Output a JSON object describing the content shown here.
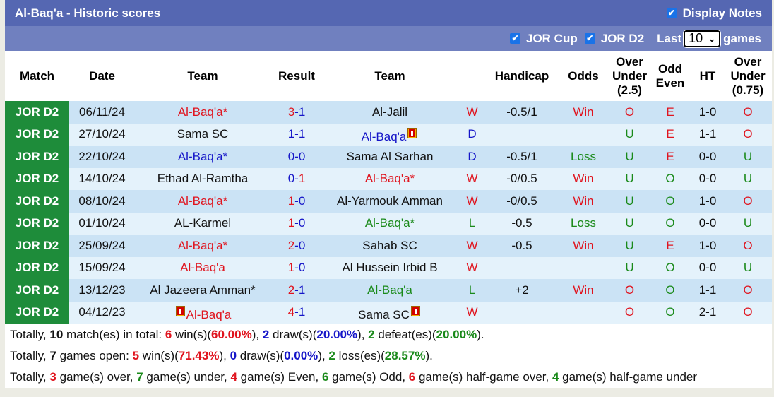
{
  "header": {
    "title": "Al-Baq'a - Historic scores",
    "display_notes_label": "Display Notes",
    "display_notes_checked": true
  },
  "filters": {
    "items": [
      {
        "label": "JOR Cup",
        "checked": true
      },
      {
        "label": "JOR D2",
        "checked": true
      }
    ],
    "last_label": "Last",
    "last_value": "10",
    "games_label": "games"
  },
  "columns": {
    "match": "Match",
    "date": "Date",
    "team1": "Team",
    "result": "Result",
    "team2": "Team",
    "handicap": "Handicap",
    "odds": "Odds",
    "ou_line1": "Over",
    "ou_line2": "Under",
    "ou_line3": "(2.5)",
    "oe_line1": "Odd",
    "oe_line2": "Even",
    "ht": "HT",
    "ou2_line1": "Over",
    "ou2_line2": "Under",
    "ou2_line3": "(0.75)"
  },
  "colors": {
    "title_bg": "#5567b2",
    "filter_bg": "#7080bf",
    "league_bg": "#1e8c3a",
    "row_odd": "#cbe3f5",
    "row_even": "#e4f2fb",
    "red": "#e0141e",
    "blue": "#1515c8",
    "green": "#1a8a1a"
  },
  "rows": [
    {
      "league": "JOR D2",
      "date": "06/11/24",
      "home": "Al-Baq'a*",
      "home_color": "red",
      "home_card_before": false,
      "home_card_after": false,
      "score_home": "3",
      "score_home_color": "red",
      "score_away": "1",
      "score_away_color": "blue",
      "away": "Al-Jalil",
      "away_color": "black",
      "away_card_before": false,
      "away_card_after": false,
      "wl": "W",
      "wl_color": "red",
      "handicap": "-0.5/1",
      "odds": "Win",
      "odds_color": "red",
      "ou": "O",
      "ou_color": "red",
      "oe": "E",
      "oe_color": "red",
      "ht": "1-0",
      "ou2": "O",
      "ou2_color": "red"
    },
    {
      "league": "JOR D2",
      "date": "27/10/24",
      "home": "Sama SC",
      "home_color": "black",
      "home_card_before": false,
      "home_card_after": false,
      "score_home": "1",
      "score_home_color": "blue",
      "score_away": "1",
      "score_away_color": "blue",
      "away": "Al-Baq'a",
      "away_color": "blue",
      "away_card_before": false,
      "away_card_after": true,
      "wl": "D",
      "wl_color": "blue",
      "handicap": "",
      "odds": "",
      "odds_color": "black",
      "ou": "U",
      "ou_color": "green",
      "oe": "E",
      "oe_color": "red",
      "ht": "1-1",
      "ou2": "O",
      "ou2_color": "red"
    },
    {
      "league": "JOR D2",
      "date": "22/10/24",
      "home": "Al-Baq'a*",
      "home_color": "blue",
      "home_card_before": false,
      "home_card_after": false,
      "score_home": "0",
      "score_home_color": "blue",
      "score_away": "0",
      "score_away_color": "blue",
      "away": "Sama Al Sarhan",
      "away_color": "black",
      "away_card_before": false,
      "away_card_after": false,
      "wl": "D",
      "wl_color": "blue",
      "handicap": "-0.5/1",
      "odds": "Loss",
      "odds_color": "green",
      "ou": "U",
      "ou_color": "green",
      "oe": "E",
      "oe_color": "red",
      "ht": "0-0",
      "ou2": "U",
      "ou2_color": "green"
    },
    {
      "league": "JOR D2",
      "date": "14/10/24",
      "home": "Ethad Al-Ramtha",
      "home_color": "black",
      "home_card_before": false,
      "home_card_after": false,
      "score_home": "0",
      "score_home_color": "blue",
      "score_away": "1",
      "score_away_color": "red",
      "away": "Al-Baq'a*",
      "away_color": "red",
      "away_card_before": false,
      "away_card_after": false,
      "wl": "W",
      "wl_color": "red",
      "handicap": "-0/0.5",
      "odds": "Win",
      "odds_color": "red",
      "ou": "U",
      "ou_color": "green",
      "oe": "O",
      "oe_color": "green",
      "ht": "0-0",
      "ou2": "U",
      "ou2_color": "green"
    },
    {
      "league": "JOR D2",
      "date": "08/10/24",
      "home": "Al-Baq'a*",
      "home_color": "red",
      "home_card_before": false,
      "home_card_after": false,
      "score_home": "1",
      "score_home_color": "red",
      "score_away": "0",
      "score_away_color": "blue",
      "away": "Al-Yarmouk Amman",
      "away_color": "black",
      "away_card_before": false,
      "away_card_after": false,
      "wl": "W",
      "wl_color": "red",
      "handicap": "-0/0.5",
      "odds": "Win",
      "odds_color": "red",
      "ou": "U",
      "ou_color": "green",
      "oe": "O",
      "oe_color": "green",
      "ht": "1-0",
      "ou2": "O",
      "ou2_color": "red"
    },
    {
      "league": "JOR D2",
      "date": "01/10/24",
      "home": "AL-Karmel",
      "home_color": "black",
      "home_card_before": false,
      "home_card_after": false,
      "score_home": "1",
      "score_home_color": "red",
      "score_away": "0",
      "score_away_color": "blue",
      "away": "Al-Baq'a*",
      "away_color": "green",
      "away_card_before": false,
      "away_card_after": false,
      "wl": "L",
      "wl_color": "green",
      "handicap": "-0.5",
      "odds": "Loss",
      "odds_color": "green",
      "ou": "U",
      "ou_color": "green",
      "oe": "O",
      "oe_color": "green",
      "ht": "0-0",
      "ou2": "U",
      "ou2_color": "green"
    },
    {
      "league": "JOR D2",
      "date": "25/09/24",
      "home": "Al-Baq'a*",
      "home_color": "red",
      "home_card_before": false,
      "home_card_after": false,
      "score_home": "2",
      "score_home_color": "red",
      "score_away": "0",
      "score_away_color": "blue",
      "away": "Sahab SC",
      "away_color": "black",
      "away_card_before": false,
      "away_card_after": false,
      "wl": "W",
      "wl_color": "red",
      "handicap": "-0.5",
      "odds": "Win",
      "odds_color": "red",
      "ou": "U",
      "ou_color": "green",
      "oe": "E",
      "oe_color": "red",
      "ht": "1-0",
      "ou2": "O",
      "ou2_color": "red"
    },
    {
      "league": "JOR D2",
      "date": "15/09/24",
      "home": "Al-Baq'a",
      "home_color": "red",
      "home_card_before": false,
      "home_card_after": false,
      "score_home": "1",
      "score_home_color": "red",
      "score_away": "0",
      "score_away_color": "blue",
      "away": "Al Hussein Irbid B",
      "away_color": "black",
      "away_card_before": false,
      "away_card_after": false,
      "wl": "W",
      "wl_color": "red",
      "handicap": "",
      "odds": "",
      "odds_color": "black",
      "ou": "U",
      "ou_color": "green",
      "oe": "O",
      "oe_color": "green",
      "ht": "0-0",
      "ou2": "U",
      "ou2_color": "green"
    },
    {
      "league": "JOR D2",
      "date": "13/12/23",
      "home": "Al Jazeera Amman*",
      "home_color": "black",
      "home_card_before": false,
      "home_card_after": false,
      "score_home": "2",
      "score_home_color": "red",
      "score_away": "1",
      "score_away_color": "blue",
      "away": "Al-Baq'a",
      "away_color": "green",
      "away_card_before": false,
      "away_card_after": false,
      "wl": "L",
      "wl_color": "green",
      "handicap": "+2",
      "odds": "Win",
      "odds_color": "red",
      "ou": "O",
      "ou_color": "red",
      "oe": "O",
      "oe_color": "green",
      "ht": "1-1",
      "ou2": "O",
      "ou2_color": "red"
    },
    {
      "league": "JOR D2",
      "date": "04/12/23",
      "home": "Al-Baq'a",
      "home_color": "red",
      "home_card_before": true,
      "home_card_after": false,
      "score_home": "4",
      "score_home_color": "red",
      "score_away": "1",
      "score_away_color": "blue",
      "away": "Sama SC",
      "away_color": "black",
      "away_card_before": false,
      "away_card_after": true,
      "wl": "W",
      "wl_color": "red",
      "handicap": "",
      "odds": "",
      "odds_color": "black",
      "ou": "O",
      "ou_color": "red",
      "oe": "O",
      "oe_color": "green",
      "ht": "2-1",
      "ou2": "O",
      "ou2_color": "red"
    }
  ],
  "summary": [
    [
      {
        "t": "Totally, ",
        "c": ""
      },
      {
        "t": "10",
        "c": "bold"
      },
      {
        "t": " match(es) in total: ",
        "c": ""
      },
      {
        "t": "6",
        "c": "red"
      },
      {
        "t": " win(s)(",
        "c": ""
      },
      {
        "t": "60.00%",
        "c": "red"
      },
      {
        "t": "), ",
        "c": ""
      },
      {
        "t": "2",
        "c": "blue"
      },
      {
        "t": " draw(s)(",
        "c": ""
      },
      {
        "t": "20.00%",
        "c": "blue"
      },
      {
        "t": "), ",
        "c": ""
      },
      {
        "t": "2",
        "c": "green"
      },
      {
        "t": " defeat(es)(",
        "c": ""
      },
      {
        "t": "20.00%",
        "c": "green"
      },
      {
        "t": ").",
        "c": ""
      }
    ],
    [
      {
        "t": "Totally, ",
        "c": ""
      },
      {
        "t": "7",
        "c": "bold"
      },
      {
        "t": " games open: ",
        "c": ""
      },
      {
        "t": "5",
        "c": "red"
      },
      {
        "t": " win(s)(",
        "c": ""
      },
      {
        "t": "71.43%",
        "c": "red"
      },
      {
        "t": "), ",
        "c": ""
      },
      {
        "t": "0",
        "c": "blue"
      },
      {
        "t": " draw(s)(",
        "c": ""
      },
      {
        "t": "0.00%",
        "c": "blue"
      },
      {
        "t": "), ",
        "c": ""
      },
      {
        "t": "2",
        "c": "green"
      },
      {
        "t": " loss(es)(",
        "c": ""
      },
      {
        "t": "28.57%",
        "c": "green"
      },
      {
        "t": ").",
        "c": ""
      }
    ],
    [
      {
        "t": "Totally, ",
        "c": ""
      },
      {
        "t": "3",
        "c": "red"
      },
      {
        "t": " game(s) over, ",
        "c": ""
      },
      {
        "t": "7",
        "c": "green"
      },
      {
        "t": " game(s) under, ",
        "c": ""
      },
      {
        "t": "4",
        "c": "red"
      },
      {
        "t": " game(s) Even, ",
        "c": ""
      },
      {
        "t": "6",
        "c": "green"
      },
      {
        "t": " game(s) Odd, ",
        "c": ""
      },
      {
        "t": "6",
        "c": "red"
      },
      {
        "t": " game(s) half-game over, ",
        "c": ""
      },
      {
        "t": "4",
        "c": "green"
      },
      {
        "t": " game(s) half-game under",
        "c": ""
      }
    ]
  ]
}
